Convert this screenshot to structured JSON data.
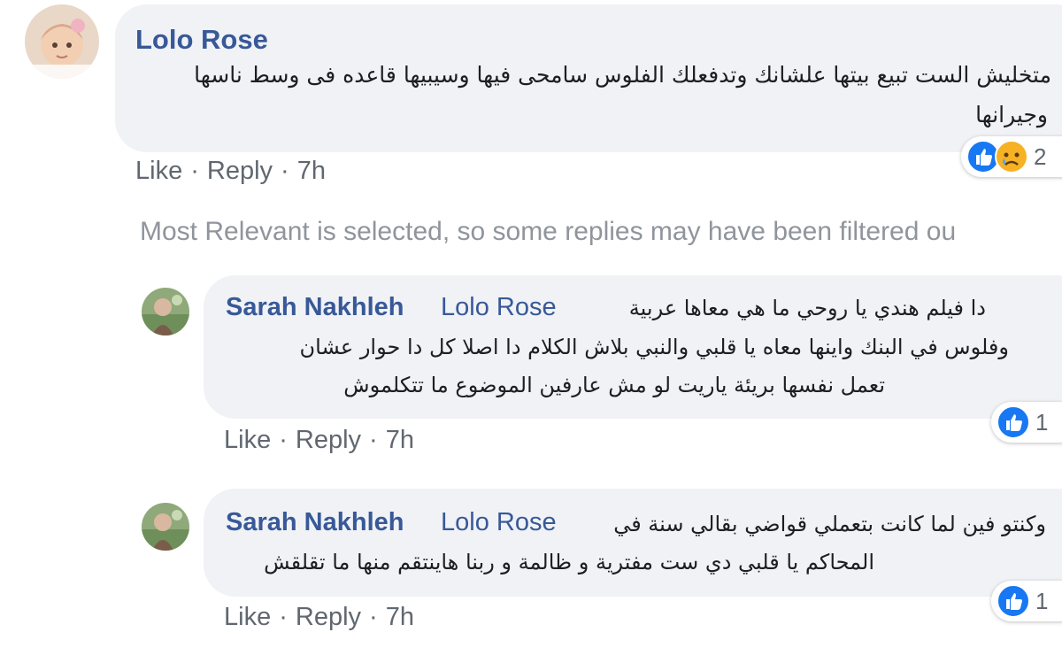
{
  "comment": {
    "author": "Lolo Rose",
    "text_line1": "متخليش الست تبيع بيتها علشانك وتدفعلك الفلوس سامحى فيها وسيبيها قاعده فى وسط ناسها",
    "text_line2": "وجيرانها",
    "reaction_count": "2",
    "reaction_icons": [
      "like-icon",
      "sad-icon"
    ],
    "actions": {
      "like": "Like",
      "reply": "Reply",
      "time": "7h"
    }
  },
  "filter_note": "Most Relevant is selected, so some replies may have been filtered ou",
  "replies": [
    {
      "author": "Sarah Nakhleh",
      "tag": "Lolo Rose",
      "text_line1": "دا فيلم هندي يا روحي ما هي معاها عربية",
      "text_line2": "وفلوس في البنك واينها معاه يا قلبي والنبي بلاش الكلام دا اصلا كل دا حوار عشان",
      "text_line3": "تعمل نفسها بريئة ياريت لو مش عارفين الموضوع ما تتكلموش",
      "reaction_count": "1",
      "actions": {
        "like": "Like",
        "reply": "Reply",
        "time": "7h"
      }
    },
    {
      "author": "Sarah Nakhleh",
      "tag": "Lolo Rose",
      "text_line1": "وكنتو فين لما كانت بتعملي قواضي بقالي سنة في",
      "text_line2": "المحاكم يا قلبي دي ست مفترية و ظالمة و ربنا هاينتقم منها ما تقلقش",
      "reaction_count": "1",
      "actions": {
        "like": "Like",
        "reply": "Reply",
        "time": "7h"
      }
    }
  ],
  "colors": {
    "name": "#385898",
    "bubble": "#f0f2f5",
    "muted": "#606770",
    "note": "#90949c",
    "like_blue": "#1877f2"
  }
}
